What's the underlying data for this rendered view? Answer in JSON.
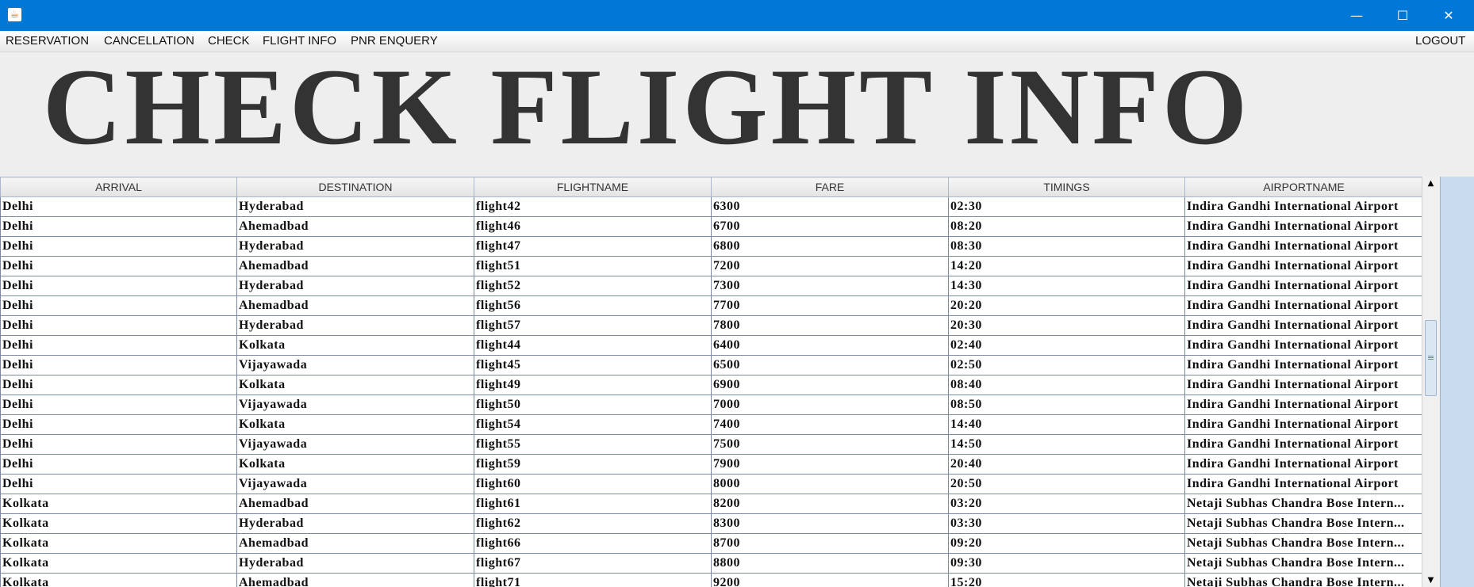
{
  "window": {
    "app_icon": "java-icon",
    "controls": {
      "minimize": "—",
      "maximize": "☐",
      "close": "✕"
    }
  },
  "menu": {
    "items": [
      "RESERVATION",
      "CANCELLATION",
      "CHECK",
      "FLIGHT INFO",
      "PNR ENQUERY"
    ],
    "logout": "LOGOUT"
  },
  "heading": "CHECK  FLIGHT  INFO",
  "table": {
    "columns": [
      "ARRIVAL",
      "DESTINATION",
      "FLIGHTNAME",
      "FARE",
      "TIMINGS",
      "AIRPORTNAME"
    ],
    "rows": [
      [
        "Delhi",
        "Hyderabad",
        "flight42",
        "6300",
        "02:30",
        "Indira Gandhi International Airport"
      ],
      [
        "Delhi",
        "Ahemadbad",
        "flight46",
        "6700",
        "08:20",
        "Indira Gandhi International Airport"
      ],
      [
        "Delhi",
        "Hyderabad",
        "flight47",
        "6800",
        "08:30",
        "Indira Gandhi International Airport"
      ],
      [
        "Delhi",
        "Ahemadbad",
        "flight51",
        "7200",
        "14:20",
        "Indira Gandhi International Airport"
      ],
      [
        "Delhi",
        "Hyderabad",
        "flight52",
        "7300",
        "14:30",
        "Indira Gandhi International Airport"
      ],
      [
        "Delhi",
        "Ahemadbad",
        "flight56",
        "7700",
        "20:20",
        "Indira Gandhi International Airport"
      ],
      [
        "Delhi",
        "Hyderabad",
        "flight57",
        "7800",
        "20:30",
        "Indira Gandhi International Airport"
      ],
      [
        "Delhi",
        "Kolkata",
        "flight44",
        "6400",
        "02:40",
        "Indira Gandhi International Airport"
      ],
      [
        "Delhi",
        "Vijayawada",
        "flight45",
        "6500",
        "02:50",
        "Indira Gandhi International Airport"
      ],
      [
        "Delhi",
        "Kolkata",
        "flight49",
        "6900",
        "08:40",
        "Indira Gandhi International Airport"
      ],
      [
        "Delhi",
        "Vijayawada",
        "flight50",
        "7000",
        "08:50",
        "Indira Gandhi International Airport"
      ],
      [
        "Delhi",
        "Kolkata",
        "flight54",
        "7400",
        "14:40",
        "Indira Gandhi International Airport"
      ],
      [
        "Delhi",
        "Vijayawada",
        "flight55",
        "7500",
        "14:50",
        "Indira Gandhi International Airport"
      ],
      [
        "Delhi",
        "Kolkata",
        "flight59",
        "7900",
        "20:40",
        "Indira Gandhi International Airport"
      ],
      [
        "Delhi",
        "Vijayawada",
        "flight60",
        "8000",
        "20:50",
        "Indira Gandhi International Airport"
      ],
      [
        "Kolkata",
        "Ahemadbad",
        "flight61",
        "8200",
        "03:20",
        "Netaji Subhas Chandra Bose Intern..."
      ],
      [
        "Kolkata",
        "Hyderabad",
        "flight62",
        "8300",
        "03:30",
        "Netaji Subhas Chandra Bose Intern..."
      ],
      [
        "Kolkata",
        "Ahemadbad",
        "flight66",
        "8700",
        "09:20",
        "Netaji Subhas Chandra Bose Intern..."
      ],
      [
        "Kolkata",
        "Hyderabad",
        "flight67",
        "8800",
        "09:30",
        "Netaji Subhas Chandra Bose Intern..."
      ],
      [
        "Kolkata",
        "Ahemadbad",
        "flight71",
        "9200",
        "15:20",
        "Netaji Subhas Chandra Bose Intern..."
      ]
    ]
  },
  "scrollbar": {
    "up_icon": "▲",
    "down_icon": "▼",
    "position_fraction": 0.42
  }
}
